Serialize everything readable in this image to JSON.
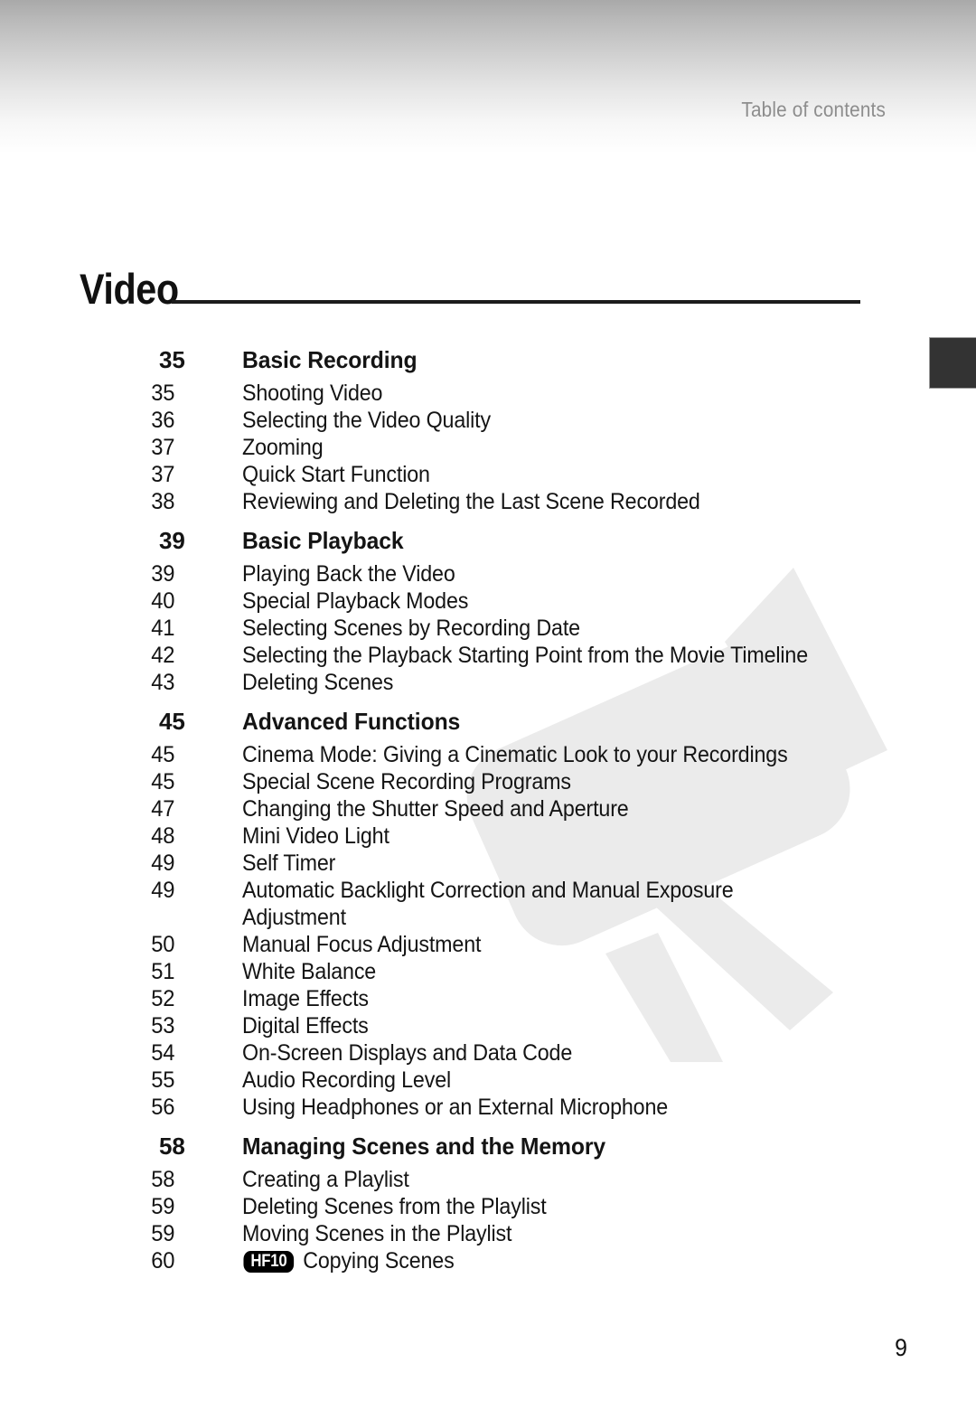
{
  "page": {
    "running_header": "Table of contents",
    "chapter_title": "Video",
    "folio": "9"
  },
  "sections": [
    {
      "page": "35",
      "title": "Basic Recording",
      "entries": [
        {
          "page": "35",
          "label": "Shooting Video"
        },
        {
          "page": "36",
          "label": "Selecting the Video Quality"
        },
        {
          "page": "37",
          "label": "Zooming"
        },
        {
          "page": "37",
          "label": "Quick Start Function"
        },
        {
          "page": "38",
          "label": "Reviewing and Deleting the Last Scene Recorded"
        }
      ]
    },
    {
      "page": "39",
      "title": "Basic Playback",
      "entries": [
        {
          "page": "39",
          "label": "Playing Back the Video"
        },
        {
          "page": "40",
          "label": "Special Playback Modes"
        },
        {
          "page": "41",
          "label": "Selecting Scenes by Recording Date"
        },
        {
          "page": "42",
          "label": "Selecting the Playback Starting Point from the Movie Timeline"
        },
        {
          "page": "43",
          "label": "Deleting Scenes"
        }
      ]
    },
    {
      "page": "45",
      "title": "Advanced Functions",
      "entries": [
        {
          "page": "45",
          "label": "Cinema Mode: Giving a Cinematic Look to your Recordings"
        },
        {
          "page": "45",
          "label": "Special Scene Recording Programs"
        },
        {
          "page": "47",
          "label": "Changing the Shutter Speed and Aperture"
        },
        {
          "page": "48",
          "label": "Mini Video Light"
        },
        {
          "page": "49",
          "label": "Self Timer"
        },
        {
          "page": "49",
          "label": "Automatic Backlight Correction and Manual Exposure"
        },
        {
          "page": "",
          "label": "Adjustment",
          "continuation": true
        },
        {
          "page": "50",
          "label": "Manual Focus Adjustment"
        },
        {
          "page": "51",
          "label": "White Balance"
        },
        {
          "page": "52",
          "label": "Image Effects"
        },
        {
          "page": "53",
          "label": "Digital Effects"
        },
        {
          "page": "54",
          "label": "On-Screen Displays and Data Code"
        },
        {
          "page": "55",
          "label": "Audio Recording Level"
        },
        {
          "page": "56",
          "label": "Using Headphones or an External Microphone"
        }
      ]
    },
    {
      "page": "58",
      "title": "Managing Scenes and the Memory",
      "entries": [
        {
          "page": "58",
          "label": "Creating a Playlist"
        },
        {
          "page": "59",
          "label": "Deleting Scenes from the Playlist"
        },
        {
          "page": "59",
          "label": "Moving Scenes in the Playlist"
        },
        {
          "page": "60",
          "label": "Copying Scenes",
          "badge": "HF10"
        }
      ]
    }
  ],
  "decor": {
    "watermark_icon": "camcorder-watermark",
    "watermark_color": "#ebebeb",
    "chapter_tab_color": "#333333"
  }
}
